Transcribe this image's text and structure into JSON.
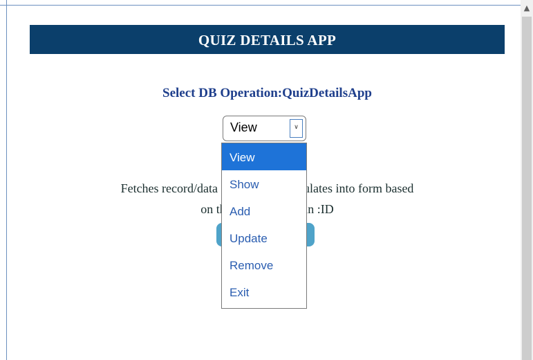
{
  "app": {
    "header_title": "QUIZ DETAILS APP",
    "subtitle": "Select DB Operation:QuizDetailsApp"
  },
  "operation_select": {
    "selected_value": "View",
    "options": [
      "View",
      "Show",
      "Add",
      "Update",
      "Remove",
      "Exit"
    ],
    "highlighted_option": "View"
  },
  "description": {
    "line1": "Fetches record/data from db and populates into form based",
    "line2": "on the value entered in :ID"
  },
  "icons": {
    "dropdown_arrow": "chevron-down-icon",
    "scroll_up": "chevron-up-icon"
  },
  "colors": {
    "header_bg": "#0b3f6b",
    "subtitle": "#1f3f8c",
    "option_text": "#2a5db0",
    "option_highlight": "#1e73d8",
    "button_bg": "#4fa3c9"
  }
}
